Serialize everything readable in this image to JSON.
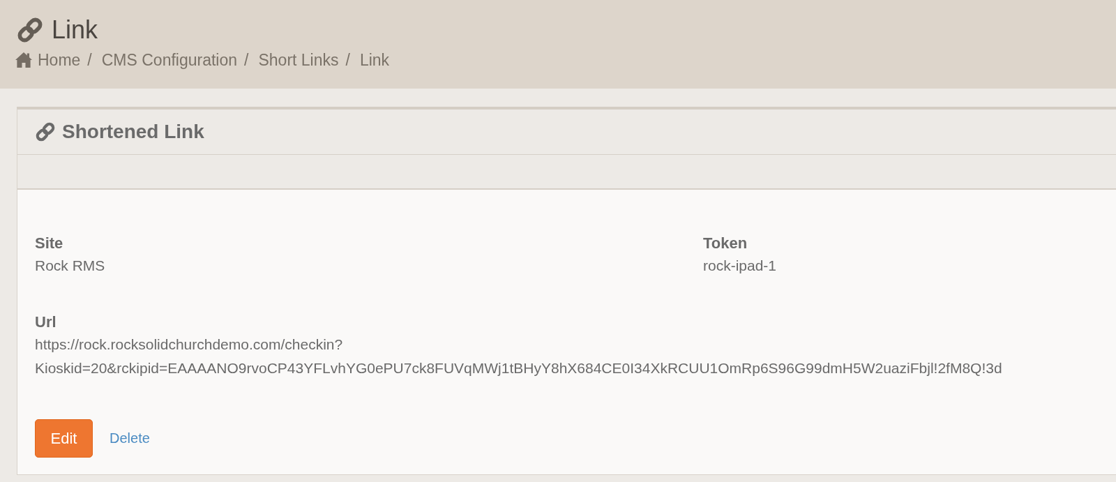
{
  "page_header": {
    "title": "Link",
    "breadcrumbs": {
      "separator": "/",
      "items": [
        {
          "label": "Home"
        },
        {
          "label": "CMS Configuration"
        },
        {
          "label": "Short Links"
        },
        {
          "label": "Link"
        }
      ]
    }
  },
  "panel": {
    "title": "Shortened Link",
    "fields": [
      {
        "label": "Site",
        "value": "Rock RMS"
      },
      {
        "label": "Token",
        "value": "rock-ipad-1"
      },
      {
        "label": "Url",
        "value": "https://rock.rocksolidchurchdemo.com/checkin?Kioskid=20&rckipid=EAAAANO9rvoCP43YFLvhYG0ePU7ck8FUVqMWj1tBHyY8hX684CE0I34XkRCUU1OmRp6S96G99dmH5W2uaziFbjl!2fM8Q!3d"
      }
    ],
    "actions": [
      {
        "kind": "primary",
        "label": "Edit"
      },
      {
        "kind": "link",
        "label": "Delete"
      }
    ]
  }
}
